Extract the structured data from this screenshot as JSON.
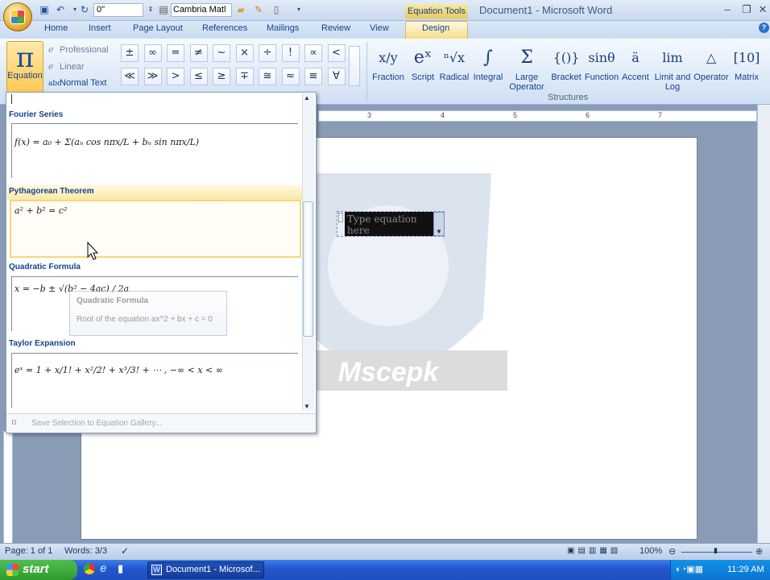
{
  "window": {
    "title": "Document1 - Microsoft Word",
    "contextual_tab": "Equation Tools"
  },
  "qat": {
    "font_size": "0\"",
    "font_name": "Cambria Matl"
  },
  "tabs": [
    "Home",
    "Insert",
    "Page Layout",
    "References",
    "Mailings",
    "Review",
    "View",
    "Design"
  ],
  "ribbon": {
    "equation_label": "Equation",
    "tools": [
      "Professional",
      "Linear",
      "Normal Text"
    ],
    "symbols": [
      "±",
      "∞",
      "=",
      "≠",
      "~",
      "×",
      "÷",
      "!",
      "∝",
      "<",
      "≪",
      "≫",
      ">",
      "≤",
      "≥",
      "∓",
      "≅",
      "≈",
      "≡",
      "∀"
    ],
    "structures": [
      {
        "label": "Fraction",
        "glyph": "x/y"
      },
      {
        "label": "Script",
        "glyph": "eˣ"
      },
      {
        "label": "Radical",
        "glyph": "ⁿ√x"
      },
      {
        "label": "Integral",
        "glyph": "∫"
      },
      {
        "label": "Large Operator",
        "glyph": "Σ"
      },
      {
        "label": "Bracket",
        "glyph": "{()}"
      },
      {
        "label": "Function",
        "glyph": "sinθ"
      },
      {
        "label": "Accent",
        "glyph": "ä"
      },
      {
        "label": "Limit and Log",
        "glyph": "lim"
      },
      {
        "label": "Operator",
        "glyph": "△"
      },
      {
        "label": "Matrix",
        "glyph": "[10]"
      }
    ],
    "group_label": "Structures"
  },
  "ruler": [
    "3",
    "4",
    "5",
    "6",
    "7"
  ],
  "gallery": {
    "items": [
      {
        "header": "Fourier Series",
        "formula": "f(x) = a₀ + Σ(aₙ cos nπx/L + bₙ sin nπx/L)"
      },
      {
        "header": "Pythagorean Theorem",
        "formula": "a² + b² = c²"
      },
      {
        "header": "Quadratic Formula",
        "formula": "x = −b ± √(b² − 4ac) / 2a"
      },
      {
        "header": "Taylor Expansion",
        "formula": "eˣ = 1 + x/1! + x²/2! + x³/3! + ⋯ ,    −∞ < x < ∞"
      }
    ],
    "footer": "Save Selection to Equation Gallery..."
  },
  "tooltip": {
    "title": "Quadratic Formula",
    "body": "Root of the equation ax^2 + bx + c = 0"
  },
  "equation_placeholder": "Type equation here",
  "watermark": "Mscepk",
  "status": {
    "page": "Page: 1 of 1",
    "words": "Words: 3/3",
    "zoom": "100%"
  },
  "taskbar": {
    "start": "start",
    "doc": "Document1 - Microsof...",
    "time": "11:29 AM"
  }
}
